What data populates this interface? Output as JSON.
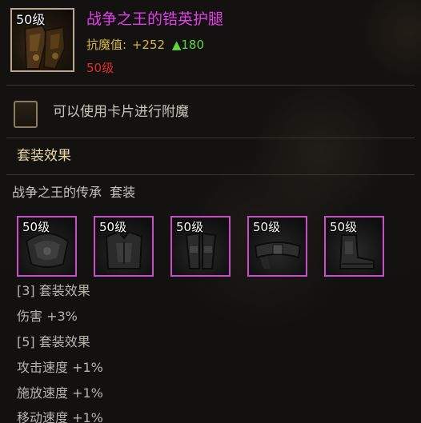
{
  "item": {
    "level_tag": "50级",
    "name": "战争之王的锆英护腿",
    "stat_label": "抗魔值:",
    "stat_base": "+252",
    "stat_bonus": "▲180",
    "required_level": "50级",
    "icon": "leg-armor-icon"
  },
  "enchant": {
    "text": "可以使用卡片进行附魔",
    "icon": "card-slot-icon"
  },
  "set": {
    "header": "套装效果",
    "name": "战争之王的传承  套装",
    "pieces": [
      {
        "level": "50级",
        "icon": "shoulder-armor-icon"
      },
      {
        "level": "50级",
        "icon": "chest-armor-icon"
      },
      {
        "level": "50级",
        "icon": "leg-armor-icon"
      },
      {
        "level": "50级",
        "icon": "belt-icon"
      },
      {
        "level": "50级",
        "icon": "boots-icon"
      }
    ],
    "bonuses": [
      "[3] 套装效果",
      "伤害 +3%",
      "[5] 套装效果",
      "攻击速度 +1%",
      "施放速度 +1%",
      "移动速度 +1%"
    ]
  },
  "colors": {
    "item_name": "#e03fe6",
    "stat": "#d6b54d",
    "stat_bonus": "#5fd63a",
    "required_level": "#e02c2c",
    "set_header": "#e9d9a6",
    "piece_border": "#c94fc9"
  }
}
